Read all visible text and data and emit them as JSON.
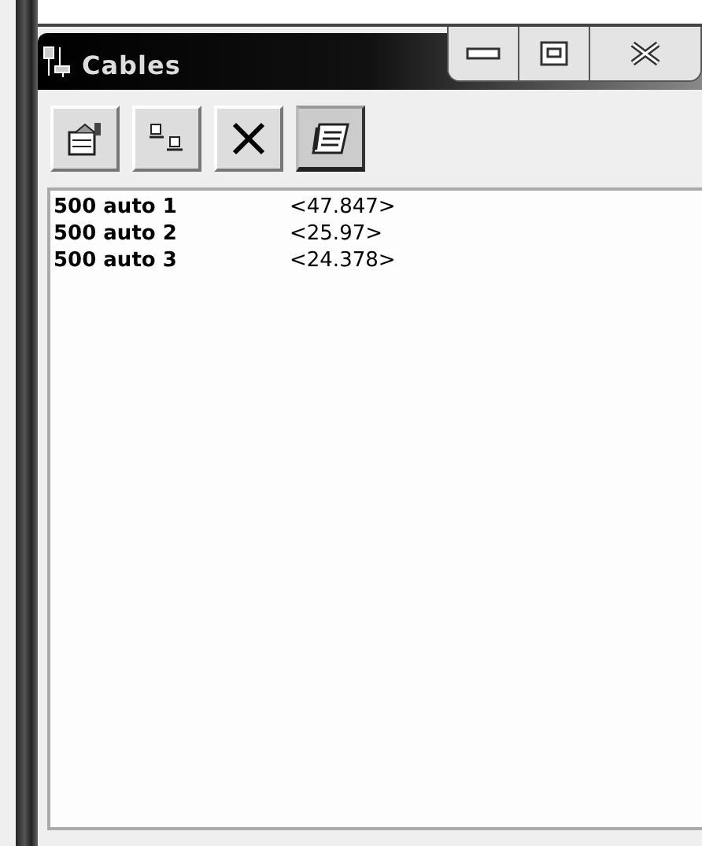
{
  "window": {
    "title": "Cables"
  },
  "toolbar": [
    {
      "kind": "properties",
      "pressed": false
    },
    {
      "kind": "arrange",
      "pressed": false
    },
    {
      "kind": "delete",
      "pressed": false
    },
    {
      "kind": "notes",
      "pressed": true
    }
  ],
  "rows": [
    {
      "name": "500 auto 1",
      "value": "<47.847>"
    },
    {
      "name": "500 auto 2",
      "value": "<25.97>"
    },
    {
      "name": "500 auto 3",
      "value": "<24.378>"
    }
  ]
}
